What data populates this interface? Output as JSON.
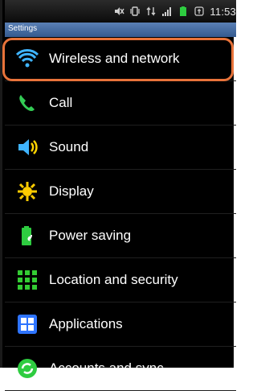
{
  "statusbar": {
    "time": "11:53",
    "icons": [
      "mute-icon",
      "vibrate-icon",
      "network-arrows-icon",
      "signal-icon",
      "battery-icon",
      "usb-icon"
    ]
  },
  "titlebar": {
    "title": "Settings"
  },
  "menu": {
    "items": [
      {
        "label": "Wireless and network",
        "icon": "wifi-icon"
      },
      {
        "label": "Call",
        "icon": "call-icon"
      },
      {
        "label": "Sound",
        "icon": "sound-icon"
      },
      {
        "label": "Display",
        "icon": "display-icon"
      },
      {
        "label": "Power saving",
        "icon": "power-saving-icon"
      },
      {
        "label": "Location and security",
        "icon": "location-security-icon"
      },
      {
        "label": "Applications",
        "icon": "applications-icon"
      },
      {
        "label": "Accounts and sync",
        "icon": "accounts-icon"
      }
    ]
  },
  "colors": {
    "highlight": "#e8733a",
    "titlebar": "#355a8f"
  }
}
